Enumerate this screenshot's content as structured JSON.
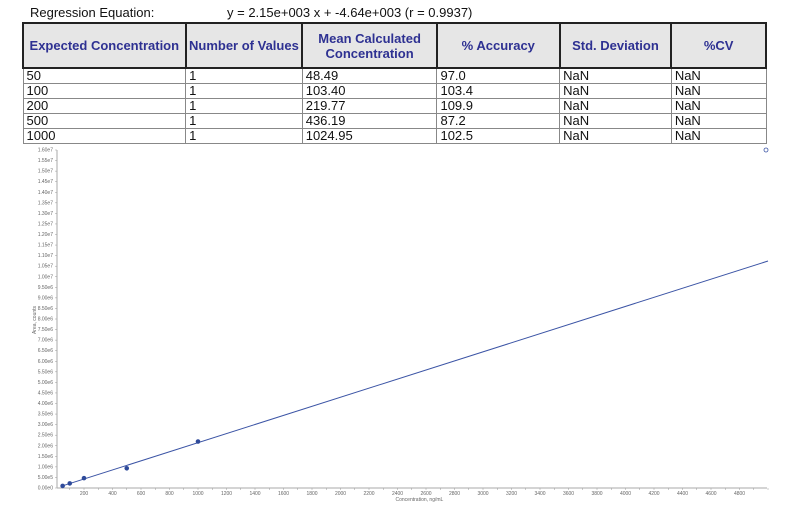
{
  "regression": {
    "label": "Regression Equation:",
    "equation": "y = 2.15e+003 x + -4.64e+003 (r = 0.9937)"
  },
  "table": {
    "headers": [
      "Expected Concentration",
      "Number of Values",
      "Mean Calculated Concentration",
      "% Accuracy",
      "Std. Deviation",
      "%CV"
    ],
    "rows": [
      [
        "50",
        "1",
        "48.49",
        "97.0",
        "NaN",
        "NaN"
      ],
      [
        "100",
        "1",
        "103.40",
        "103.4",
        "NaN",
        "NaN"
      ],
      [
        "200",
        "1",
        "219.77",
        "109.9",
        "NaN",
        "NaN"
      ],
      [
        "500",
        "1",
        "436.19",
        "87.2",
        "NaN",
        "NaN"
      ],
      [
        "1000",
        "1",
        "1024.95",
        "102.5",
        "NaN",
        "NaN"
      ]
    ]
  },
  "chart_data": {
    "type": "scatter",
    "xlabel": "Concentration, ng/mL",
    "ylabel": "Area, counts",
    "xlim": [
      0,
      5000
    ],
    "ylim": [
      0,
      16000000
    ],
    "x_ticks": [
      "200",
      "400",
      "600",
      "800",
      "1000",
      "1200",
      "1400",
      "1600",
      "1800",
      "2000",
      "2200",
      "2400",
      "2600",
      "2800",
      "3000",
      "3200",
      "3400",
      "3600",
      "3800",
      "4000",
      "4200",
      "4400",
      "4600",
      "4800"
    ],
    "y_ticks": [
      "0.00e0",
      "5.00e5",
      "1.00e6",
      "1.50e6",
      "2.00e6",
      "2.50e6",
      "3.00e6",
      "3.50e6",
      "4.00e6",
      "4.50e6",
      "5.00e6",
      "5.50e6",
      "6.00e6",
      "6.50e6",
      "7.00e6",
      "7.50e6",
      "8.00e6",
      "8.50e6",
      "9.00e6",
      "9.50e6",
      "1.00e7",
      "1.05e7",
      "1.10e7",
      "1.15e7",
      "1.20e7",
      "1.25e7",
      "1.30e7",
      "1.35e7",
      "1.40e7",
      "1.45e7",
      "1.50e7",
      "1.55e7",
      "1.60e7"
    ],
    "points": [
      {
        "x": 50,
        "y": 100000
      },
      {
        "x": 100,
        "y": 218000
      },
      {
        "x": 200,
        "y": 468000
      },
      {
        "x": 500,
        "y": 933000
      },
      {
        "x": 1000,
        "y": 2199000
      }
    ],
    "fit": {
      "slope": 2150,
      "intercept": -4640,
      "x_range": [
        50,
        5000
      ]
    },
    "colors": {
      "points": "#2e4a9a",
      "line": "#3b54a5",
      "header_text": "#2e3192"
    }
  }
}
